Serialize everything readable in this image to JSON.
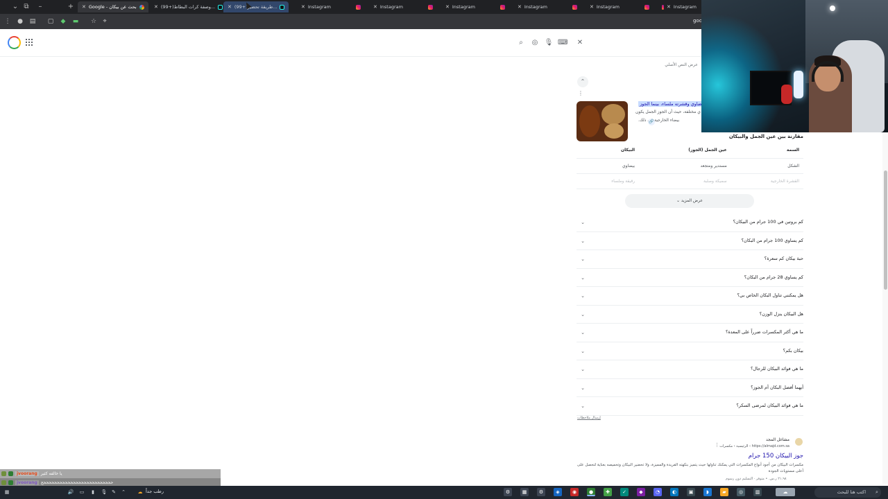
{
  "browser": {
    "tabs": [
      {
        "title": "Google - بحث عن بيكان"
      },
      {
        "title": "(99+)وصفة كرات البطاط..."
      },
      {
        "title": "(99+)طريقة تحضير..."
      },
      {
        "title": "Instagram"
      },
      {
        "title": "Instagram"
      },
      {
        "title": "Instagram"
      },
      {
        "title": "Instagram"
      },
      {
        "title": "Instagram"
      },
      {
        "title": "Instagram"
      }
    ],
    "address_fragment": "goo"
  },
  "search": {
    "original_text_link": "عرض النص الأصلي",
    "snippet": {
      "highlight": "بيضاوي وقشرته ملساء، بينما الجوز",
      "line2": "ي مختلفة، حيث أن الجوز الجمل يكون",
      "line3": "بيضاء الخارجية في ذلك."
    },
    "table": {
      "title": "مقارنة بين عين الجمل والبيكان",
      "headers": [
        "السمة",
        "عين الجمل (الجوز)",
        "البيكان"
      ],
      "rows": [
        [
          "الشكل",
          "مستدير ومتجعد",
          "بيضاوي"
        ],
        [
          "القشرة الخارجية",
          "سميكة وصلبة",
          "رقيقة وملساء"
        ]
      ]
    },
    "show_more_label": "عرض المزيد",
    "paa": [
      "كم بروتين في 100 جرام من البيكان؟",
      "كم يساوي 100 جرام من البكان؟",
      "حبة بيكان كم سعرة؟",
      "كم يساوي 28 جرام من البكان؟",
      "هل يمكنني تناول البكان الخاص بي؟",
      "هل البيكان ينزل الوزن؟",
      "ما هي أكثر المكسرات ضرراً على المعدة؟",
      "بيكان بكم؟",
      "ما هي فوائد البيكان للرجال؟",
      "أيهما أفضل البكان أم الجوز؟",
      "ما هي فوائد البيكان لمرضى السكر؟"
    ],
    "feedback_label": "إرسال ملاحظات",
    "result2": {
      "site": "مشاغل المجد",
      "url": "https://almajd.com.sa › الرئيسية › مكسرات",
      "title": "جوز البيكان 150 جرام",
      "desc": "مكسرات البيكان من أجود أنواع المكسرات التي يمكنك تناولها حيث يتميز بنكهته الفريدة والمميزة، ولا تحضير البيكان وتحميصه بعناية لتحصل على أعلى مستويات الجودة",
      "meta": "٢١.٩٨ ر.س. • متوفر · التسليم دون رسوم"
    }
  },
  "chat": [
    {
      "user": "jvoorang",
      "message": "يا خالفه كثير"
    },
    {
      "user": "jvoorang",
      "message": "ححححححححححححححححححححححححححح"
    }
  ],
  "taskbar": {
    "weather": "رطب جداً",
    "search_placeholder": "اكتب هنا للبحث"
  },
  "colors": {
    "link": "#1a0dab",
    "highlight": "#c7dbff",
    "taskbar": "#20262f"
  }
}
